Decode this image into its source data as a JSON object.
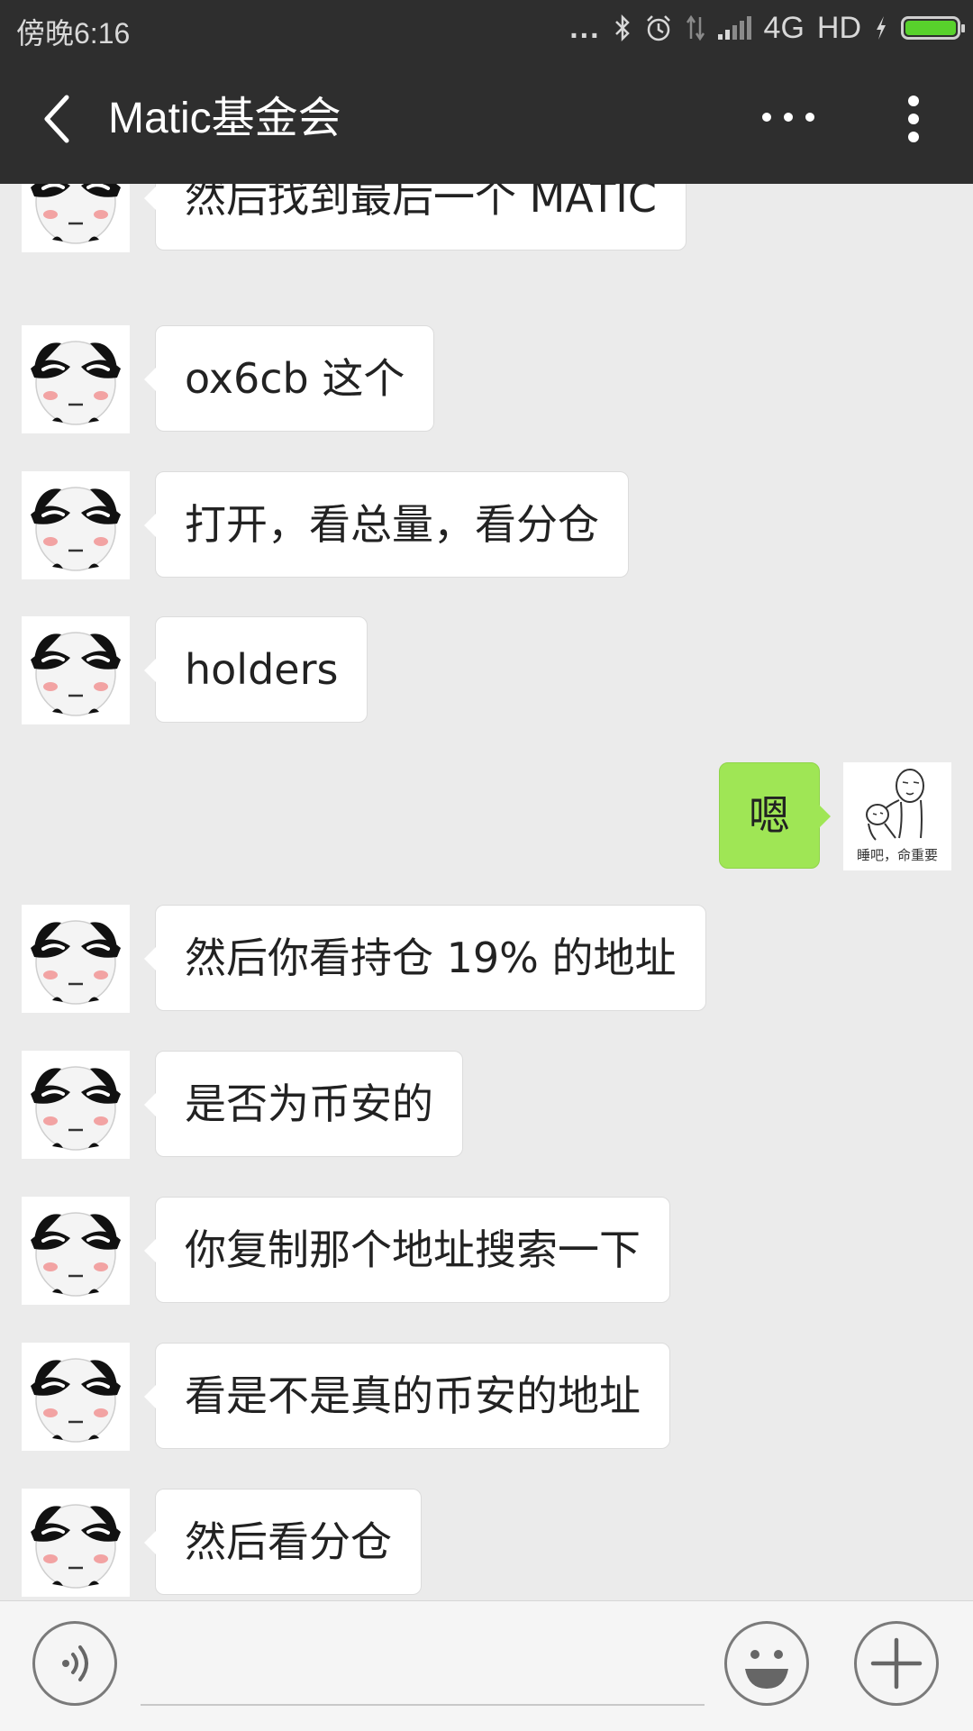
{
  "status_bar": {
    "time": "傍晚6:16",
    "dots": "...",
    "network": "4G",
    "hd": "HD"
  },
  "header": {
    "title": "Matic基金会"
  },
  "messages": [
    {
      "from": "other",
      "text": "然后找到最后一个 MATIC"
    },
    {
      "from": "other",
      "text": "ox6cb 这个"
    },
    {
      "from": "other",
      "text": "打开，看总量，看分仓"
    },
    {
      "from": "other",
      "text": "holders"
    },
    {
      "from": "me",
      "text": "嗯",
      "sticker_caption": "睡吧，命重要"
    },
    {
      "from": "other",
      "text": "然后你看持仓 19% 的地址"
    },
    {
      "from": "other",
      "text": "是否为币安的"
    },
    {
      "from": "other",
      "text": "你复制那个地址搜索一下"
    },
    {
      "from": "other",
      "text": "看是不是真的币安的地址"
    },
    {
      "from": "other",
      "text": "然后看分仓"
    }
  ],
  "input": {
    "value": "",
    "placeholder": ""
  },
  "icons": {
    "back": "chevron-left-icon",
    "more": "more-horizontal-icon",
    "kebab": "more-vertical-icon",
    "voice": "voice-icon",
    "emoji": "emoji-icon",
    "plus": "plus-icon"
  },
  "colors": {
    "header_bg": "#2e2e2e",
    "chat_bg": "#ebebeb",
    "my_bubble": "#9fe655",
    "other_bubble": "#ffffff",
    "battery": "#58d12c"
  }
}
